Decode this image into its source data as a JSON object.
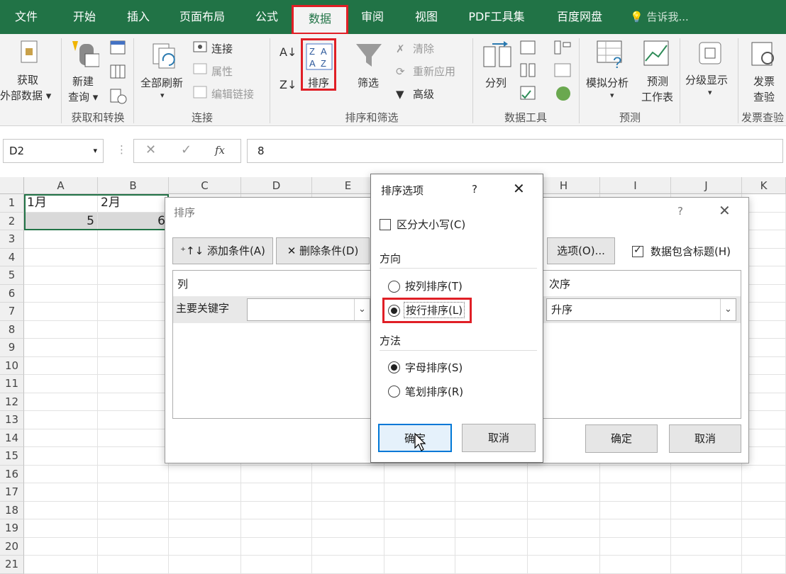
{
  "tabs": [
    "文件",
    "开始",
    "插入",
    "页面布局",
    "公式",
    "数据",
    "审阅",
    "视图",
    "PDF工具集",
    "百度网盘"
  ],
  "tell_me": "告诉我...",
  "ribbon": {
    "get_data": [
      "获取",
      "外部数据 ▾"
    ],
    "new_query": [
      "新建",
      "查询 ▾"
    ],
    "group_get_transform": "获取和转换",
    "refresh_all": "全部刷新",
    "connections": "连接",
    "properties": "属性",
    "edit_links": "编辑链接",
    "group_connections": "连接",
    "sort": "排序",
    "filter": "筛选",
    "clear": "清除",
    "reapply": "重新应用",
    "advanced": "高级",
    "group_sort_filter": "排序和筛选",
    "text_to_columns": "分列",
    "group_data_tools": "数据工具",
    "what_if": "模拟分析",
    "forecast_sheet": [
      "预测",
      "工作表"
    ],
    "group_forecast": "预测",
    "outline": "分级显示",
    "invoice_check": [
      "发票",
      "查验"
    ],
    "group_invoice": "发票查验"
  },
  "formula_bar": {
    "name_box": "D2",
    "fx": "fx",
    "value": "8"
  },
  "columns": [
    "A",
    "B",
    "C",
    "D",
    "E",
    "F",
    "G",
    "H",
    "I",
    "J",
    "K"
  ],
  "rows": [
    "1",
    "2",
    "3",
    "4",
    "5",
    "6",
    "7",
    "8",
    "9",
    "10",
    "11",
    "12",
    "13",
    "14",
    "15",
    "16",
    "17",
    "18",
    "19",
    "20",
    "21"
  ],
  "cells": {
    "A1": "1月",
    "B1": "2月",
    "A2": "5",
    "B2": "6"
  },
  "sort_dialog": {
    "title": "排序",
    "help": "?",
    "add_level": "添加条件(A)",
    "delete_level": "删除条件(D)",
    "options": "选项(O)...",
    "has_headers": "数据包含标题(H)",
    "col_header": "列",
    "order_header": "次序",
    "sort_by": "主要关键字",
    "order_value": "升序",
    "ok": "确定",
    "cancel": "取消"
  },
  "options_dialog": {
    "title": "排序选项",
    "help": "?",
    "case_sensitive": "区分大小写(C)",
    "orientation_label": "方向",
    "top_to_bottom": "按列排序(T)",
    "left_to_right": "按行排序(L)",
    "method_label": "方法",
    "letter_sort": "字母排序(S)",
    "stroke_sort": "笔划排序(R)",
    "ok": "确定",
    "cancel": "取消"
  },
  "colors": {
    "excel_green": "#217346",
    "highlight_red": "#e01f26"
  }
}
